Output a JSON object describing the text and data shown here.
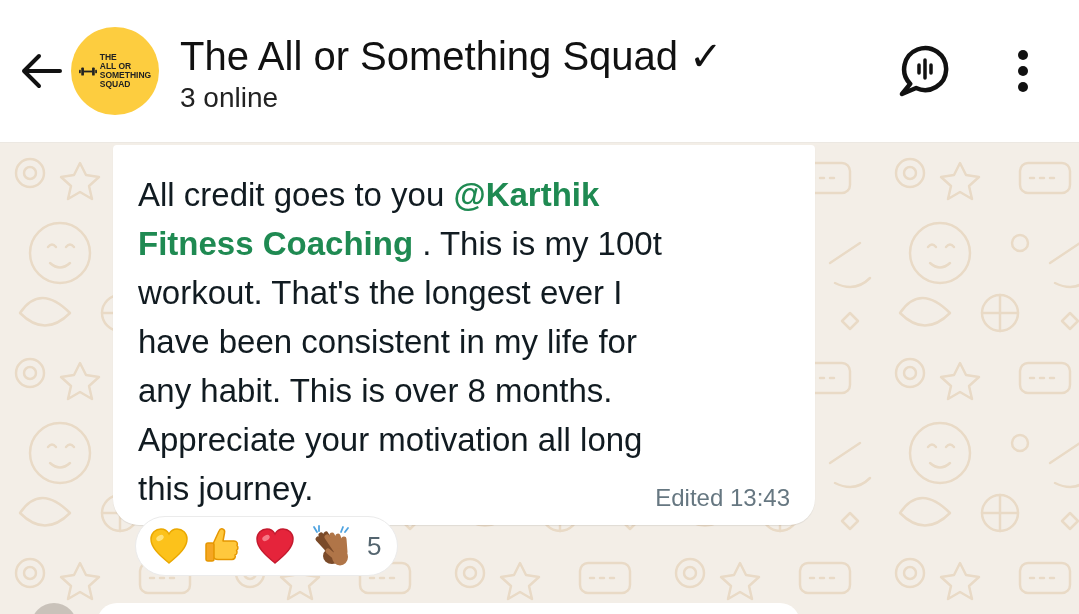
{
  "header": {
    "avatar_text": "THE\nALL OR\nSOMETHING\nSQUAD",
    "title": "The All or Something Squad ✓",
    "subtitle": "3 online"
  },
  "message": {
    "text": "All credit goes to you **@Karthik**\n**Fitness Coaching** . This is my 100t\nworkout. That's the longest ever I\nhave been consistent in my life for\nany habit. This is over 8 months.\nAppreciate your motivation all long\nthis journey.",
    "meta": "Edited 13:43"
  },
  "reactions": {
    "count": "5"
  }
}
